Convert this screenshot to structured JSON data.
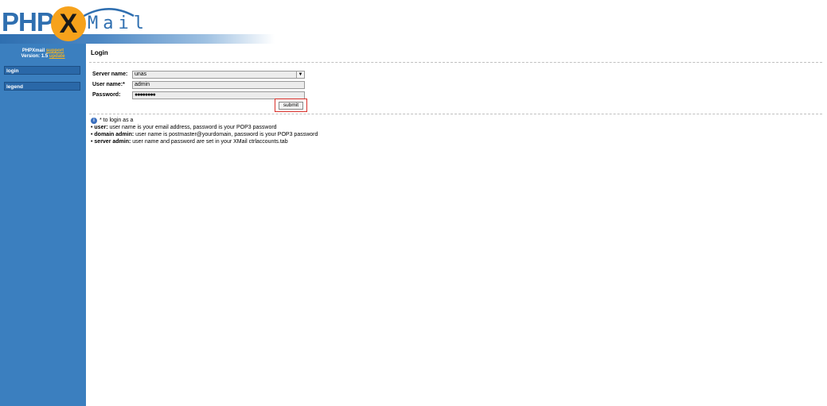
{
  "logo": {
    "part1": "PHP",
    "part2": "X",
    "part3": "Mail"
  },
  "sidebar": {
    "app_name": "PHPXmail",
    "support_link": "support",
    "version_label": "Version: 1.5",
    "update_link": "update",
    "items": [
      {
        "label": "login"
      },
      {
        "label": "legend"
      }
    ]
  },
  "main": {
    "title": "Login",
    "form": {
      "server_label": "Server name:",
      "server_value": "unas",
      "username_label": "User name:*",
      "username_value": "admin",
      "password_label": "Password:",
      "password_value": "●●●●●●●●",
      "submit_label": "submit"
    },
    "legend": {
      "note": "* to login as a",
      "bullets": [
        {
          "role": "user:",
          "text": " user name is your email address, password is your POP3 password"
        },
        {
          "role": "domain admin:",
          "text": " user name is postmaster@yourdomain, password is your POP3 password"
        },
        {
          "role": "server admin:",
          "text": " user name and password are set in your XMail ctrlaccounts.tab"
        }
      ]
    }
  },
  "colors": {
    "sidebar_bg": "#3b7fbf",
    "brand_blue": "#2f6fb0",
    "brand_orange": "#f7a21b",
    "highlight_red": "#d9302a"
  }
}
